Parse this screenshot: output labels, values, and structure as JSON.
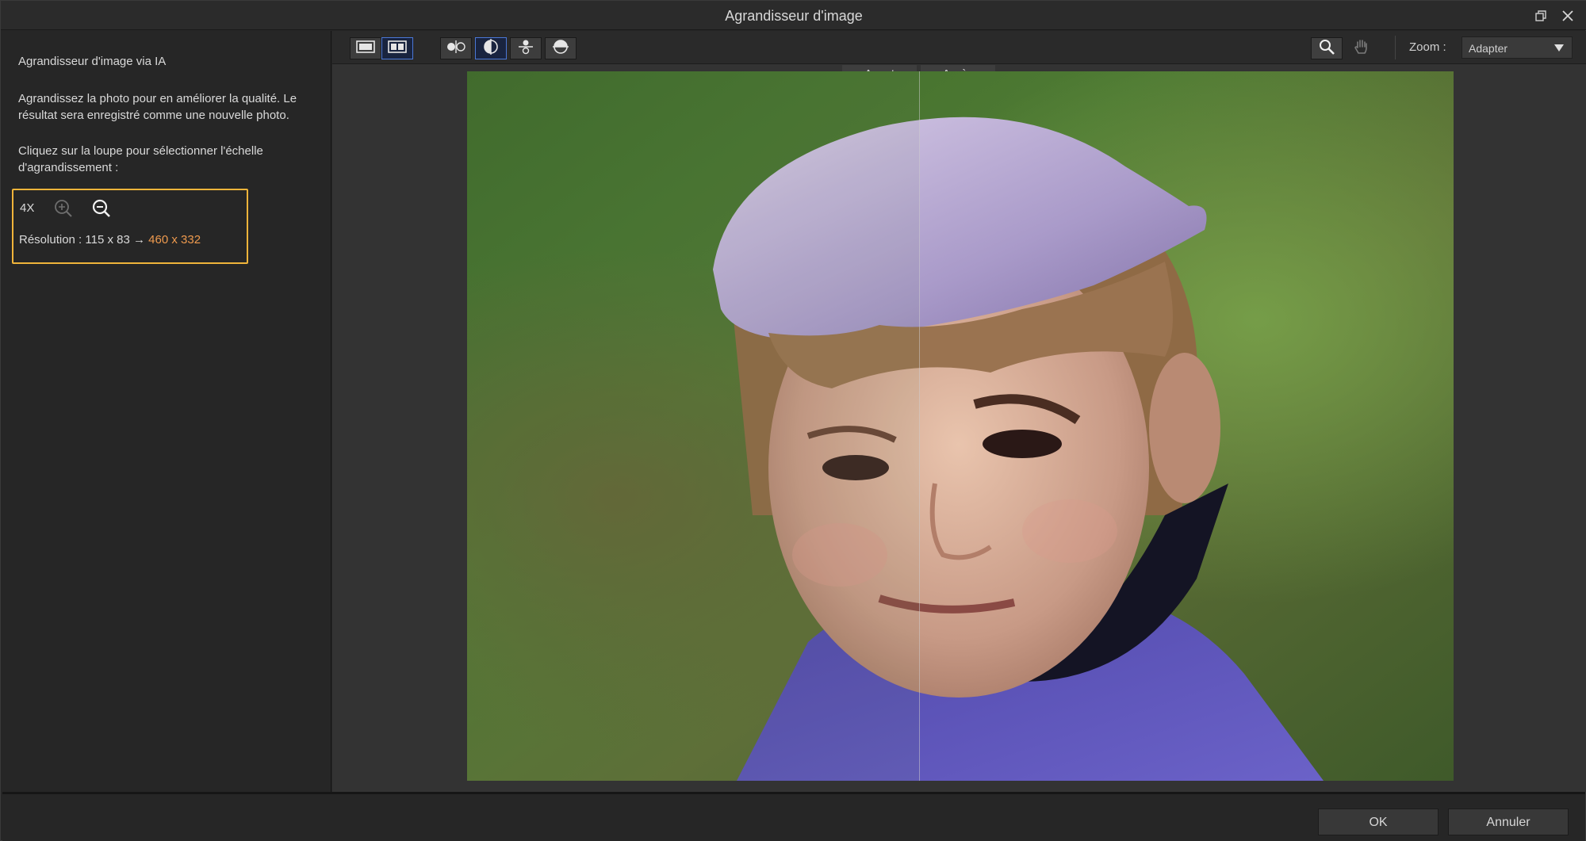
{
  "window": {
    "title": "Agrandisseur d'image"
  },
  "left_panel": {
    "heading": "Agrandisseur d'image via IA",
    "description": "Agrandissez la photo pour en améliorer la qualité. Le résultat sera enregistré comme une nouvelle photo.",
    "instruction": "Cliquez sur la loupe pour sélectionner l'échelle d'agrandissement :",
    "scale_label": "4X",
    "resolution_prefix": "Résolution : 115 x 83 →",
    "resolution_target": "460 x 332"
  },
  "toolbar": {
    "zoom_label": "Zoom :",
    "zoom_value": "Adapter"
  },
  "viewer": {
    "before_label": "Avant",
    "after_label": "Après"
  },
  "footer": {
    "ok_label": "OK",
    "cancel_label": "Annuler"
  },
  "colors": {
    "accent_border": "#f0b43a",
    "highlight_text": "#ee9a4e",
    "active_button": "#4a77d6"
  },
  "icons": {
    "restore": "restore-window-icon",
    "close": "close-icon",
    "single_view": "single-view-icon",
    "side_by_side": "side-by-side-view-icon",
    "split_vertical": "split-vertical-icon",
    "split_half": "compare-half-icon",
    "split_horizontal": "split-horizontal-icon",
    "split_horizontal_alt": "split-horizontal-alt-icon",
    "magnifier": "magnifier-icon",
    "hand": "hand-pan-icon",
    "zoom_in": "zoom-in-icon",
    "zoom_out": "zoom-out-icon"
  }
}
